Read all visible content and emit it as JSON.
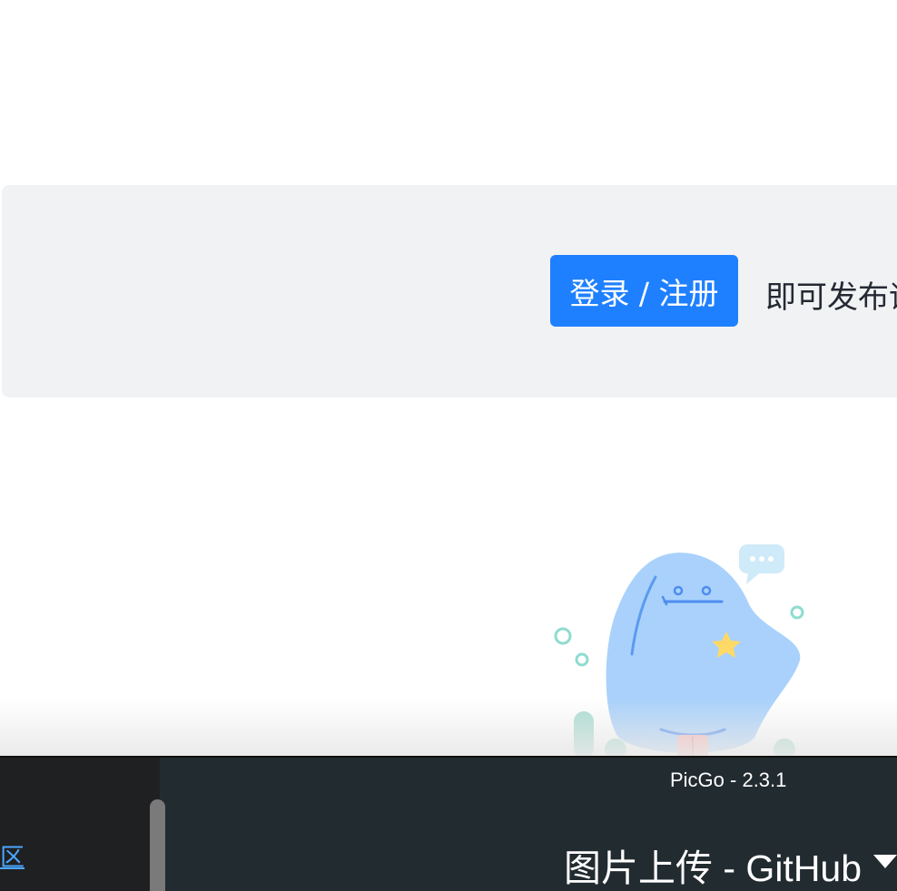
{
  "login_prompt": {
    "button_label": "登录 / 注册",
    "hint_text": "即可发布评论！"
  },
  "illustration": {
    "icon": "mascot-illustration"
  },
  "picgo": {
    "window_title": "PicGo - 2.3.1",
    "upload_title": "图片上传 - GitHub",
    "dropdown_icon": "chevron-down-icon",
    "side_link_text": "区"
  },
  "colors": {
    "accent": "#1e80ff",
    "panel_bg": "#f1f2f4",
    "bar_bg": "#222b30",
    "link": "#4ba6ff"
  }
}
